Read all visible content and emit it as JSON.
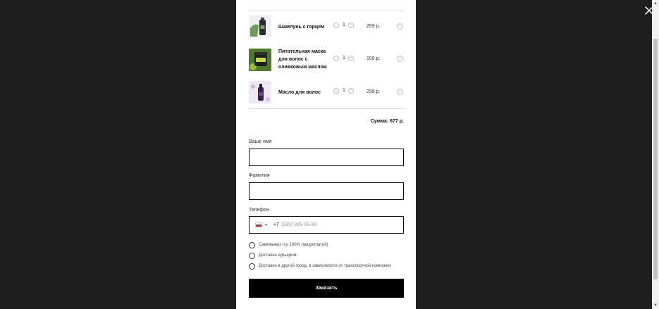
{
  "cart": {
    "items": [
      {
        "name": "Шампунь с горцем",
        "qty": "1",
        "price": "259 р.",
        "minus": "−",
        "plus": "+",
        "remove": "×",
        "thumb_icon": "shampoo-bottle"
      },
      {
        "name": "Питательная маска для волос с оливковым маслом",
        "qty": "1",
        "price": "159 р.",
        "minus": "−",
        "plus": "+",
        "remove": "×",
        "thumb_icon": "hair-mask-jar"
      },
      {
        "name": "Масло для волос",
        "qty": "1",
        "price": "259 р.",
        "minus": "−",
        "plus": "+",
        "remove": "×",
        "thumb_icon": "oil-bottle"
      }
    ],
    "total": "Сумма: 677 р."
  },
  "form": {
    "name_label": "Ваше имя",
    "name_value": "",
    "surname_label": "Фамилия",
    "surname_value": "",
    "phone_label": "Телефон",
    "phone_prefix": "+7",
    "phone_placeholder": "(999) 999-99-99",
    "flag_caret": "▼",
    "delivery_options": [
      "Самовывоз (со 100% предоплатой)",
      "Доставка курьером",
      "Доставка в другой город, в зависимости от транспортной компании"
    ],
    "submit_label": "Заказать"
  },
  "colors": {
    "overlay": "#1e1e1e",
    "modal_bg": "#ffffff",
    "button_bg": "#000000",
    "flag": [
      "#ffffff",
      "#1c57a5",
      "#d52b1e"
    ]
  },
  "icons": {
    "close": "close-icon",
    "scroll_up": "▲",
    "scroll_down": "▼"
  }
}
